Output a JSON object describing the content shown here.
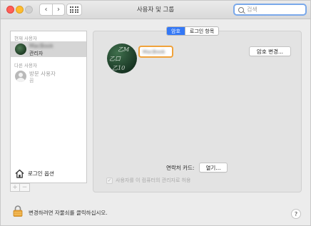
{
  "window": {
    "title": "사용자 및 그룹",
    "nav": {
      "back_icon": "chevron-left",
      "forward_icon": "chevron-right",
      "grid_icon": "show-all-grid"
    }
  },
  "search": {
    "placeholder": "검색",
    "value": ""
  },
  "sidebar": {
    "current_user_header": "현재 사용자",
    "current_user": {
      "name": "MacBook",
      "role": "관리자",
      "selected": true
    },
    "other_users_header": "다른 사용자",
    "other_users": [
      {
        "name": "방문 사용자",
        "status": "끔"
      }
    ],
    "login_options_label": "로그인 옵션",
    "add_label": "+",
    "remove_label": "−"
  },
  "tabs": [
    {
      "label": "암호",
      "active": true
    },
    {
      "label": "로그인 항목",
      "active": false
    }
  ],
  "profile": {
    "full_name": "MacBook",
    "avatar_chalk_lines": [
      "乙M",
      "乙口",
      "乙10"
    ]
  },
  "buttons": {
    "change_password": "암호 변경...",
    "open": "열기..."
  },
  "contact_card_label": "연락처 카드:",
  "admin_checkbox": {
    "label": "사용자를 이 컴퓨터의 관리자로 허용",
    "checked": true,
    "enabled": false
  },
  "footer": {
    "lock_text": "변경하려면 자물쇠를 클릭하십시오.",
    "help_label": "?"
  },
  "colors": {
    "accent": "#3478f6",
    "focus_ring": "#f0a23b",
    "close": "#ff5f57",
    "minimize": "#febc2e"
  }
}
